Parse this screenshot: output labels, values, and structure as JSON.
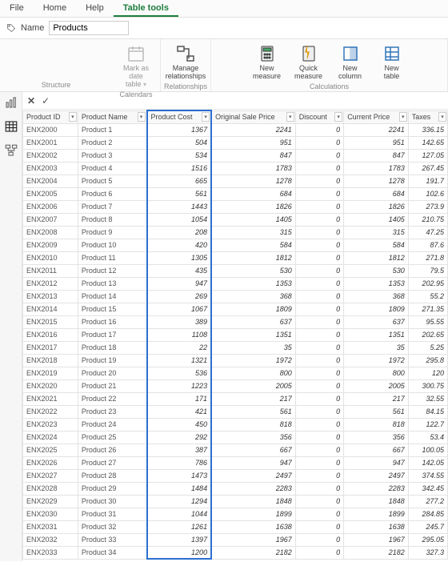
{
  "tabs": {
    "file": "File",
    "home": "Home",
    "help": "Help",
    "tabletools": "Table tools"
  },
  "namebar": {
    "label": "Name",
    "value": "Products"
  },
  "ribbon": {
    "structure_label": "Structure",
    "calendars_label": "Calendars",
    "relationships_label": "Relationships",
    "calculations_label": "Calculations",
    "mark_as_date": "Mark as date",
    "mark_as_date2": "table",
    "manage_rel": "Manage",
    "manage_rel2": "relationships",
    "new_measure": "New",
    "new_measure2": "measure",
    "quick_measure": "Quick",
    "quick_measure2": "measure",
    "new_column": "New",
    "new_column2": "column",
    "new_table": "New",
    "new_table2": "table"
  },
  "columns": {
    "id": "Product ID",
    "name": "Product Name",
    "cost": "Product Cost",
    "orig": "Original Sale Price",
    "disc": "Discount",
    "curr": "Current Price",
    "tax": "Taxes"
  },
  "chart_data": {
    "type": "table",
    "rows": [
      {
        "id": "ENX2000",
        "name": "Product 1",
        "cost": 1367,
        "orig": 2241,
        "disc": 0,
        "curr": 2241,
        "tax": 336.15
      },
      {
        "id": "ENX2001",
        "name": "Product 2",
        "cost": 504,
        "orig": 951,
        "disc": 0,
        "curr": 951,
        "tax": 142.65
      },
      {
        "id": "ENX2002",
        "name": "Product 3",
        "cost": 534,
        "orig": 847,
        "disc": 0,
        "curr": 847,
        "tax": 127.05
      },
      {
        "id": "ENX2003",
        "name": "Product 4",
        "cost": 1516,
        "orig": 1783,
        "disc": 0,
        "curr": 1783,
        "tax": 267.45
      },
      {
        "id": "ENX2004",
        "name": "Product 5",
        "cost": 665,
        "orig": 1278,
        "disc": 0,
        "curr": 1278,
        "tax": 191.7
      },
      {
        "id": "ENX2005",
        "name": "Product 6",
        "cost": 561,
        "orig": 684,
        "disc": 0,
        "curr": 684,
        "tax": 102.6
      },
      {
        "id": "ENX2006",
        "name": "Product 7",
        "cost": 1443,
        "orig": 1826,
        "disc": 0,
        "curr": 1826,
        "tax": 273.9
      },
      {
        "id": "ENX2007",
        "name": "Product 8",
        "cost": 1054,
        "orig": 1405,
        "disc": 0,
        "curr": 1405,
        "tax": 210.75
      },
      {
        "id": "ENX2008",
        "name": "Product 9",
        "cost": 208,
        "orig": 315,
        "disc": 0,
        "curr": 315,
        "tax": 47.25
      },
      {
        "id": "ENX2009",
        "name": "Product 10",
        "cost": 420,
        "orig": 584,
        "disc": 0,
        "curr": 584,
        "tax": 87.6
      },
      {
        "id": "ENX2010",
        "name": "Product 11",
        "cost": 1305,
        "orig": 1812,
        "disc": 0,
        "curr": 1812,
        "tax": 271.8
      },
      {
        "id": "ENX2011",
        "name": "Product 12",
        "cost": 435,
        "orig": 530,
        "disc": 0,
        "curr": 530,
        "tax": 79.5
      },
      {
        "id": "ENX2012",
        "name": "Product 13",
        "cost": 947,
        "orig": 1353,
        "disc": 0,
        "curr": 1353,
        "tax": 202.95
      },
      {
        "id": "ENX2013",
        "name": "Product 14",
        "cost": 269,
        "orig": 368,
        "disc": 0,
        "curr": 368,
        "tax": 55.2
      },
      {
        "id": "ENX2014",
        "name": "Product 15",
        "cost": 1067,
        "orig": 1809,
        "disc": 0,
        "curr": 1809,
        "tax": 271.35
      },
      {
        "id": "ENX2015",
        "name": "Product 16",
        "cost": 389,
        "orig": 637,
        "disc": 0,
        "curr": 637,
        "tax": 95.55
      },
      {
        "id": "ENX2016",
        "name": "Product 17",
        "cost": 1108,
        "orig": 1351,
        "disc": 0,
        "curr": 1351,
        "tax": 202.65
      },
      {
        "id": "ENX2017",
        "name": "Product 18",
        "cost": 22,
        "orig": 35,
        "disc": 0,
        "curr": 35,
        "tax": 5.25
      },
      {
        "id": "ENX2018",
        "name": "Product 19",
        "cost": 1321,
        "orig": 1972,
        "disc": 0,
        "curr": 1972,
        "tax": 295.8
      },
      {
        "id": "ENX2019",
        "name": "Product 20",
        "cost": 536,
        "orig": 800,
        "disc": 0,
        "curr": 800,
        "tax": 120
      },
      {
        "id": "ENX2020",
        "name": "Product 21",
        "cost": 1223,
        "orig": 2005,
        "disc": 0,
        "curr": 2005,
        "tax": 300.75
      },
      {
        "id": "ENX2021",
        "name": "Product 22",
        "cost": 171,
        "orig": 217,
        "disc": 0,
        "curr": 217,
        "tax": 32.55
      },
      {
        "id": "ENX2022",
        "name": "Product 23",
        "cost": 421,
        "orig": 561,
        "disc": 0,
        "curr": 561,
        "tax": 84.15
      },
      {
        "id": "ENX2023",
        "name": "Product 24",
        "cost": 450,
        "orig": 818,
        "disc": 0,
        "curr": 818,
        "tax": 122.7
      },
      {
        "id": "ENX2024",
        "name": "Product 25",
        "cost": 292,
        "orig": 356,
        "disc": 0,
        "curr": 356,
        "tax": 53.4
      },
      {
        "id": "ENX2025",
        "name": "Product 26",
        "cost": 387,
        "orig": 667,
        "disc": 0,
        "curr": 667,
        "tax": 100.05
      },
      {
        "id": "ENX2026",
        "name": "Product 27",
        "cost": 786,
        "orig": 947,
        "disc": 0,
        "curr": 947,
        "tax": 142.05
      },
      {
        "id": "ENX2027",
        "name": "Product 28",
        "cost": 1473,
        "orig": 2497,
        "disc": 0,
        "curr": 2497,
        "tax": 374.55
      },
      {
        "id": "ENX2028",
        "name": "Product 29",
        "cost": 1484,
        "orig": 2283,
        "disc": 0,
        "curr": 2283,
        "tax": 342.45
      },
      {
        "id": "ENX2029",
        "name": "Product 30",
        "cost": 1294,
        "orig": 1848,
        "disc": 0,
        "curr": 1848,
        "tax": 277.2
      },
      {
        "id": "ENX2030",
        "name": "Product 31",
        "cost": 1044,
        "orig": 1899,
        "disc": 0,
        "curr": 1899,
        "tax": 284.85
      },
      {
        "id": "ENX2031",
        "name": "Product 32",
        "cost": 1261,
        "orig": 1638,
        "disc": 0,
        "curr": 1638,
        "tax": 245.7
      },
      {
        "id": "ENX2032",
        "name": "Product 33",
        "cost": 1397,
        "orig": 1967,
        "disc": 0,
        "curr": 1967,
        "tax": 295.05
      },
      {
        "id": "ENX2033",
        "name": "Product 34",
        "cost": 1200,
        "orig": 2182,
        "disc": 0,
        "curr": 2182,
        "tax": 327.3
      }
    ]
  }
}
